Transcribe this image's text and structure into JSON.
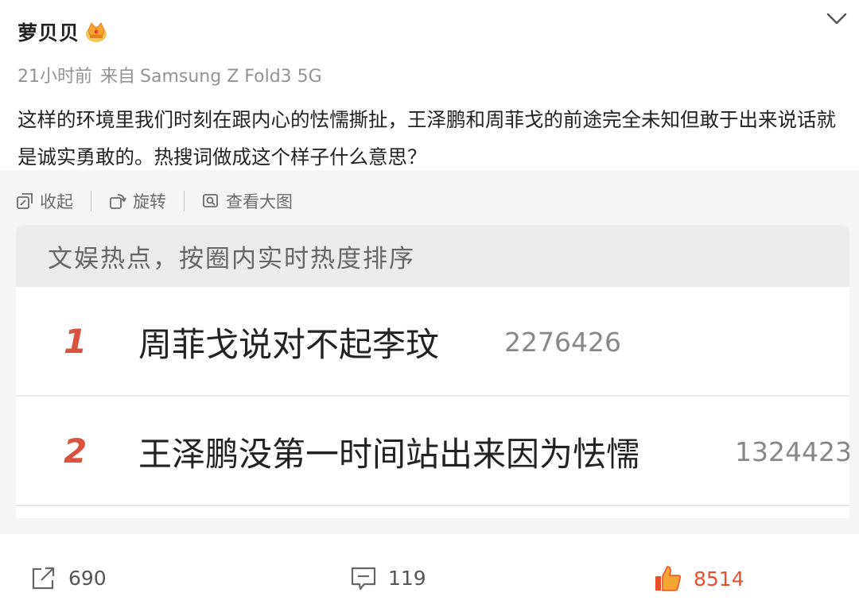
{
  "post": {
    "author": "萝贝贝",
    "time": "21小时前",
    "source_label": "来自",
    "device": "Samsung Z Fold3 5G",
    "text": "这样的环境里我们时刻在跟内心的怯懦撕扯，王泽鹏和周菲戈的前途完全未知但敢于出来说话就是诚实勇敢的。热搜词做成这个样子什么意思？"
  },
  "toolbar": {
    "collapse": "收起",
    "rotate": "旋转",
    "view_large": "查看大图"
  },
  "hot_card": {
    "header": "文娱热点，按圈内实时热度排序",
    "items": [
      {
        "rank": "1",
        "term": "周菲戈说对不起李玟",
        "heat": "2276426"
      },
      {
        "rank": "2",
        "term": "王泽鹏没第一时间站出来因为怯懦",
        "heat": "1324423"
      }
    ]
  },
  "actions": {
    "repost_count": "690",
    "comment_count": "119",
    "like_count": "8514"
  },
  "colors": {
    "rank": "#d9533f",
    "like": "#e8502c",
    "meta": "#939393"
  },
  "icons": [
    "chevron-down-icon",
    "crown-icon",
    "collapse-icon",
    "rotate-icon",
    "view-image-icon",
    "share-icon",
    "comment-icon",
    "like-icon"
  ]
}
